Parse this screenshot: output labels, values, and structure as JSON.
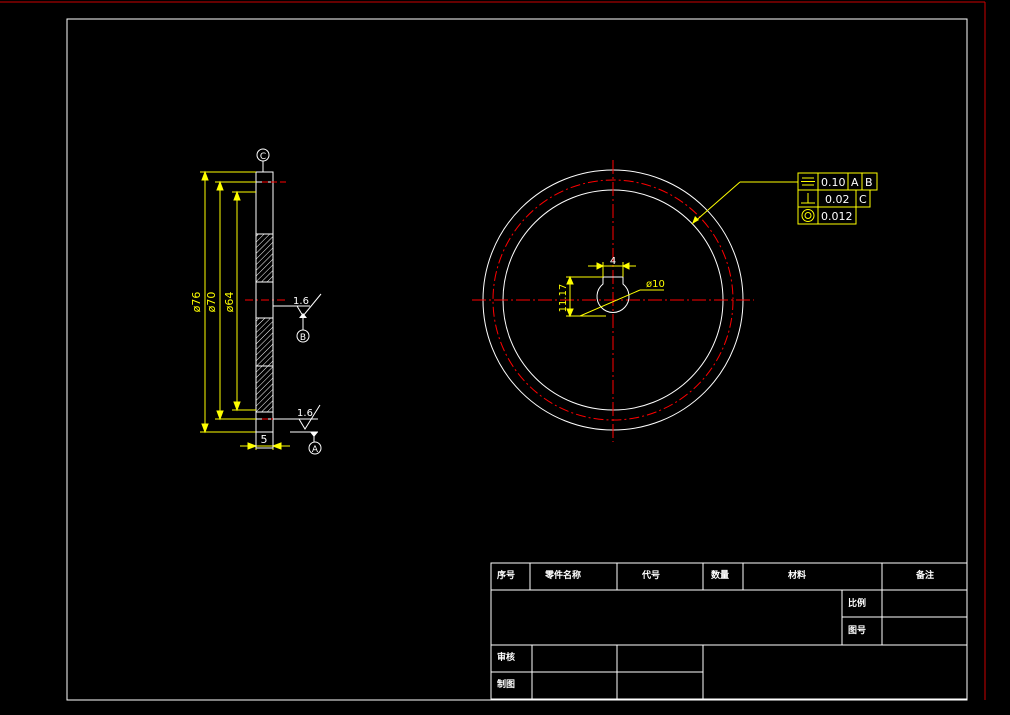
{
  "colors": {
    "background": "#000000",
    "outline": "#ffffff",
    "center_line": "#ff0000",
    "dimension": "#ffff00",
    "sheet_border": "#cc0000"
  },
  "section_view": {
    "dims": {
      "d76": "ø76",
      "d70": "ø70",
      "d64": "ø64",
      "width": "5"
    },
    "datums": {
      "top": "C",
      "mid": "B",
      "bottom": "A"
    },
    "roughness": {
      "mid": "1.6",
      "bottom": "1.6"
    }
  },
  "front_view": {
    "dims": {
      "key_width": "4",
      "key_depth": "11.17",
      "bore": "ø10"
    },
    "tolerances": [
      {
        "symbol": "symmetry-icon",
        "value": "0.10",
        "refs": [
          "A",
          "B"
        ]
      },
      {
        "symbol": "perpendicularity-icon",
        "value": "0.02",
        "refs": [
          "C"
        ]
      },
      {
        "symbol": "concentricity-icon",
        "value": "0.012",
        "refs": []
      }
    ]
  },
  "title_block": {
    "headers": {
      "seq": "序号",
      "part_name": "零件名称",
      "code": "代号",
      "qty": "数量",
      "material": "材料",
      "remark": "备注"
    },
    "scale_label": "比例",
    "drawing_no_label": "图号",
    "reviewer_label": "审核",
    "drafter_label": "制图"
  }
}
